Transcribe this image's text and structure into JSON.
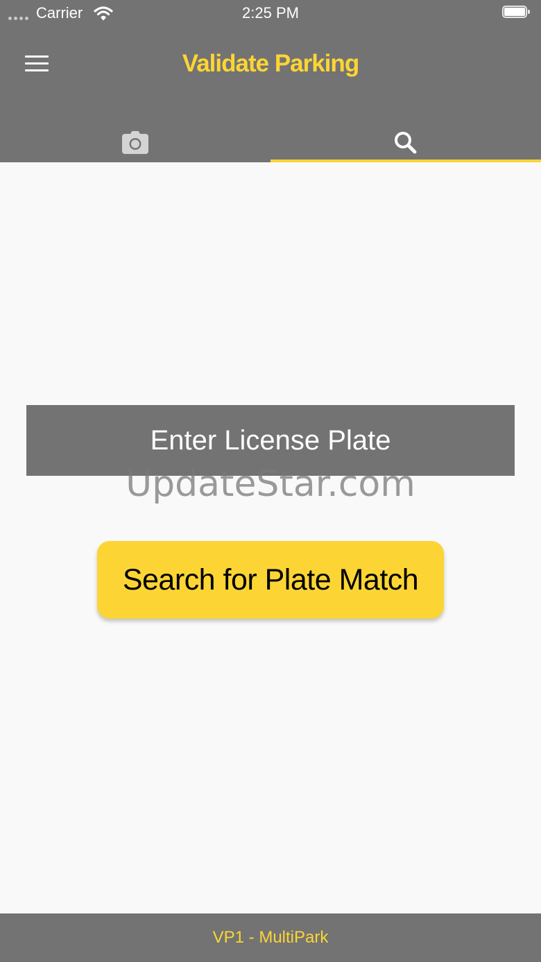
{
  "status_bar": {
    "carrier": "Carrier",
    "time": "2:25 PM",
    "signal_icon": "signal-dots-icon",
    "wifi_icon": "wifi-icon",
    "battery_icon": "battery-icon"
  },
  "header": {
    "title": "Validate Parking",
    "menu_icon": "hamburger-menu-icon",
    "tabs": [
      {
        "icon": "camera-icon",
        "selected": false
      },
      {
        "icon": "search-icon",
        "selected": true
      }
    ]
  },
  "main": {
    "plate_input": {
      "placeholder": "Enter License Plate",
      "value": ""
    },
    "watermark": "UpdateStar.com",
    "search_button_label": "Search for Plate Match"
  },
  "footer": {
    "label": "VP1 - MultiPark"
  },
  "colors": {
    "bar_background": "#737373",
    "accent": "#fcd535",
    "page_background": "#f9f9f9"
  }
}
